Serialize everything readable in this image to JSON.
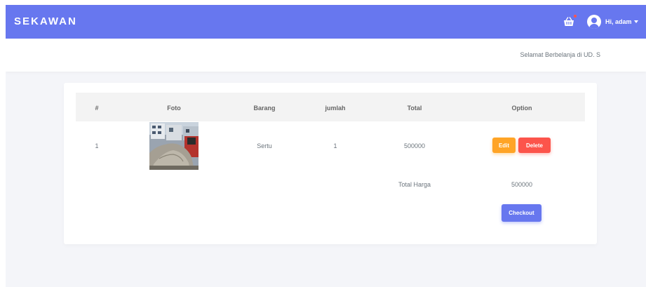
{
  "navbar": {
    "brand": "SEKAWAN",
    "user_greeting": "Hi, adam",
    "cart_icon": "basket-icon",
    "avatar_icon": "user-avatar-icon",
    "color": "#6777ef"
  },
  "subheader": {
    "welcome_text": "Selamat Berbelanja di UD. S"
  },
  "cart_table": {
    "headers": [
      "#",
      "Foto",
      "Barang",
      "jumlah",
      "Total",
      "Option"
    ],
    "rows": [
      {
        "no": "1",
        "photo": "sand-pile-photo",
        "item": "Sertu",
        "qty": "1",
        "total": "500000",
        "edit_label": "Edit",
        "delete_label": "Delete"
      }
    ],
    "total_label": "Total Harga",
    "total_value": "500000",
    "checkout_label": "Checkout"
  },
  "colors": {
    "primary": "#6777ef",
    "warning": "#ffa426",
    "danger": "#fc544b",
    "background": "#f4f5f9"
  }
}
